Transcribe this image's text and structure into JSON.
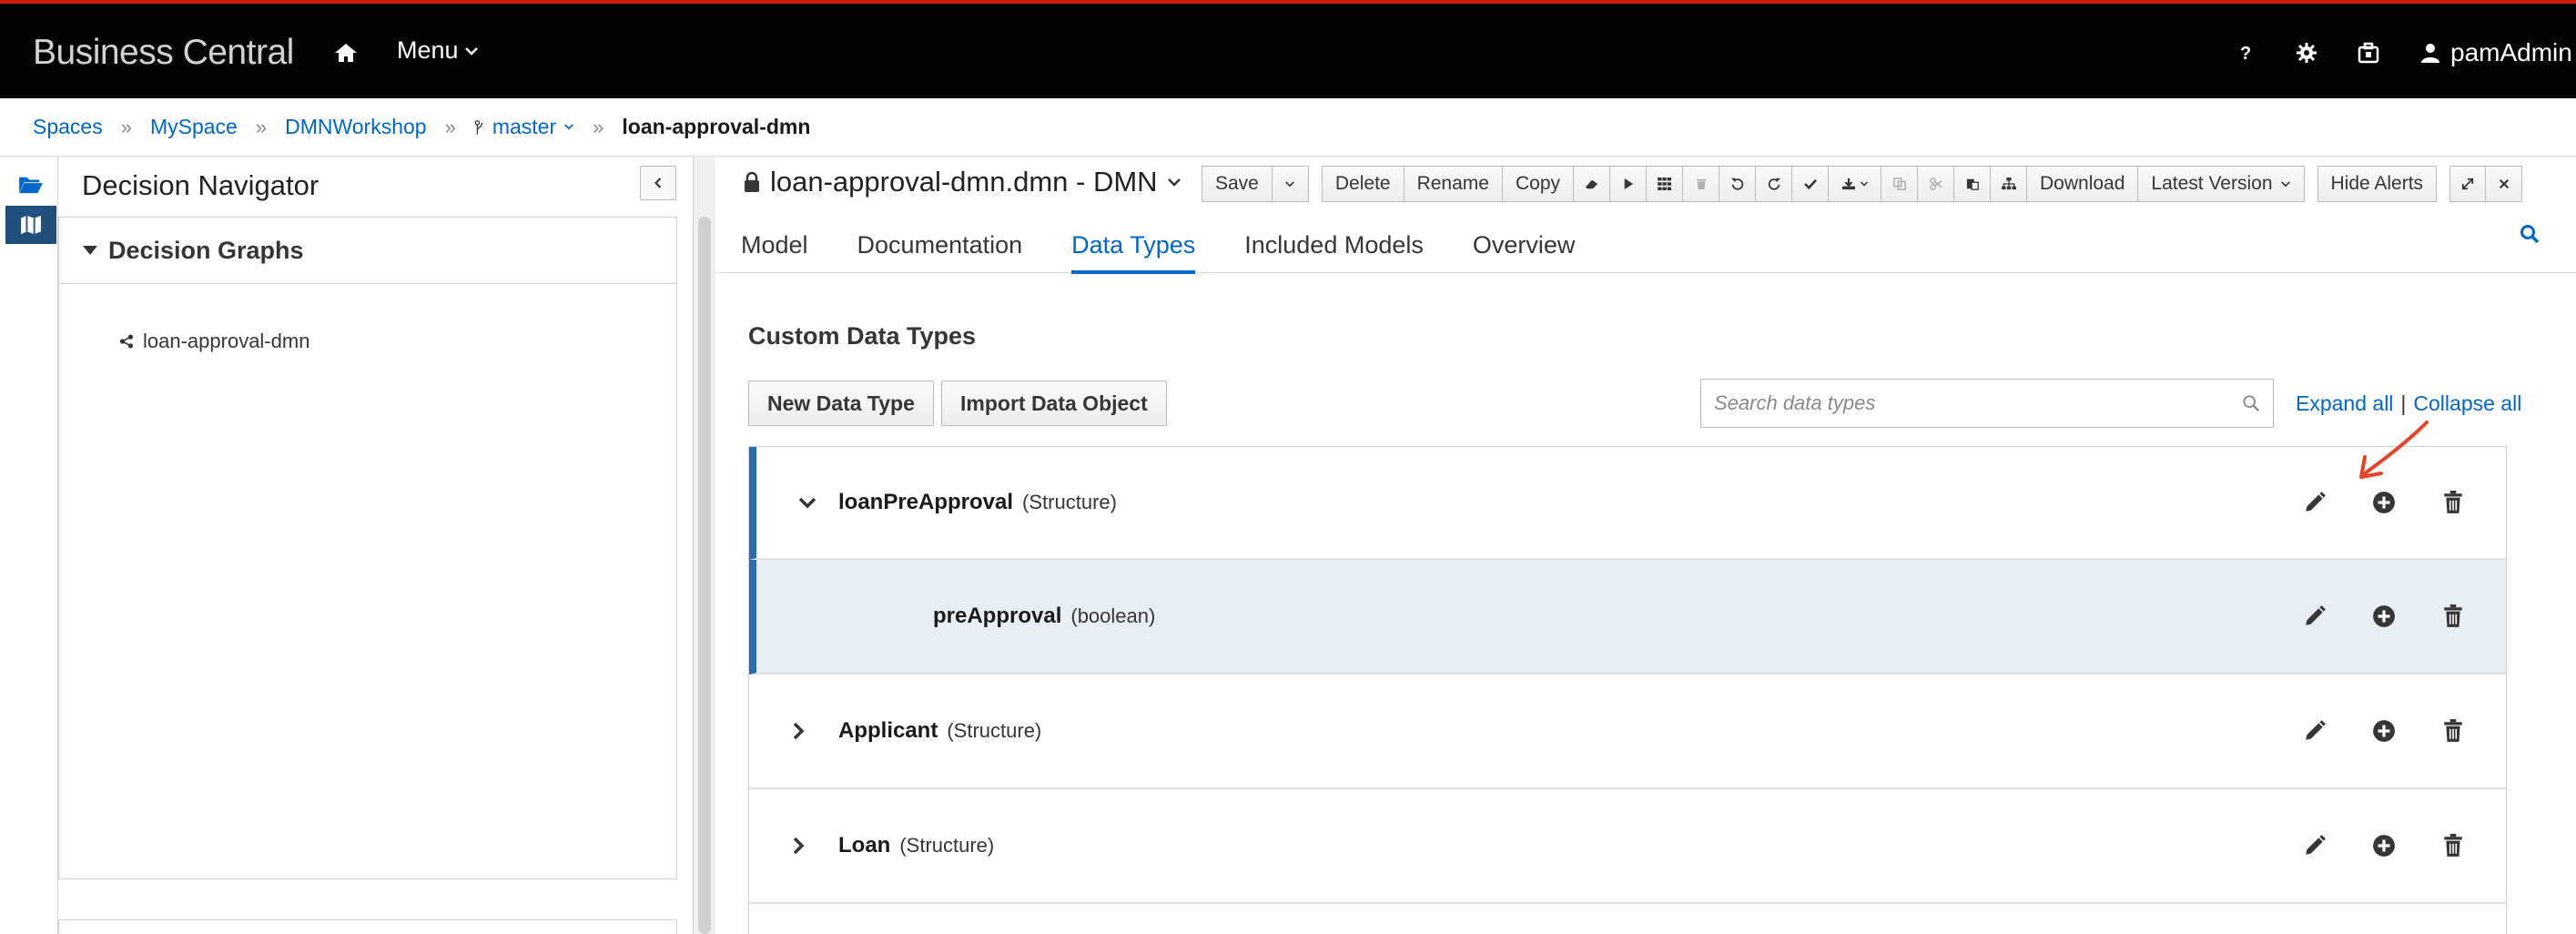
{
  "app": {
    "brand": "Business Central",
    "menu_label": "Menu",
    "user": "pamAdmin"
  },
  "breadcrumb": {
    "items": [
      "Spaces",
      "MySpace",
      "DMNWorkshop"
    ],
    "branch": "master",
    "current": "loan-approval-dmn"
  },
  "navigator": {
    "title": "Decision Navigator",
    "section": "Decision Graphs",
    "items": [
      "loan-approval-dmn"
    ]
  },
  "editor": {
    "title": "loan-approval-dmn.dmn - DMN",
    "toolbar": {
      "save": "Save",
      "delete": "Delete",
      "rename": "Rename",
      "copy": "Copy",
      "download": "Download",
      "latest_version": "Latest Version",
      "hide_alerts": "Hide Alerts"
    },
    "tabs": [
      "Model",
      "Documentation",
      "Data Types",
      "Included Models",
      "Overview"
    ],
    "active_tab": "Data Types"
  },
  "data_types": {
    "heading": "Custom Data Types",
    "new_button": "New Data Type",
    "import_button": "Import Data Object",
    "search_placeholder": "Search data types",
    "expand_all": "Expand all",
    "separator": "|",
    "collapse_all": "Collapse all",
    "rows": [
      {
        "name": "loanPreApproval",
        "type": "(Structure)",
        "expanded": true
      },
      {
        "name": "preApproval",
        "type": "(boolean)"
      },
      {
        "name": "Applicant",
        "type": "(Structure)"
      },
      {
        "name": "Loan",
        "type": "(Structure)"
      }
    ]
  },
  "colors": {
    "accent": "#0066cc",
    "topbar": "#030303",
    "topbar_border": "#c9190b",
    "selected_row": "#e8eef6",
    "annotation": "#e8412c"
  }
}
